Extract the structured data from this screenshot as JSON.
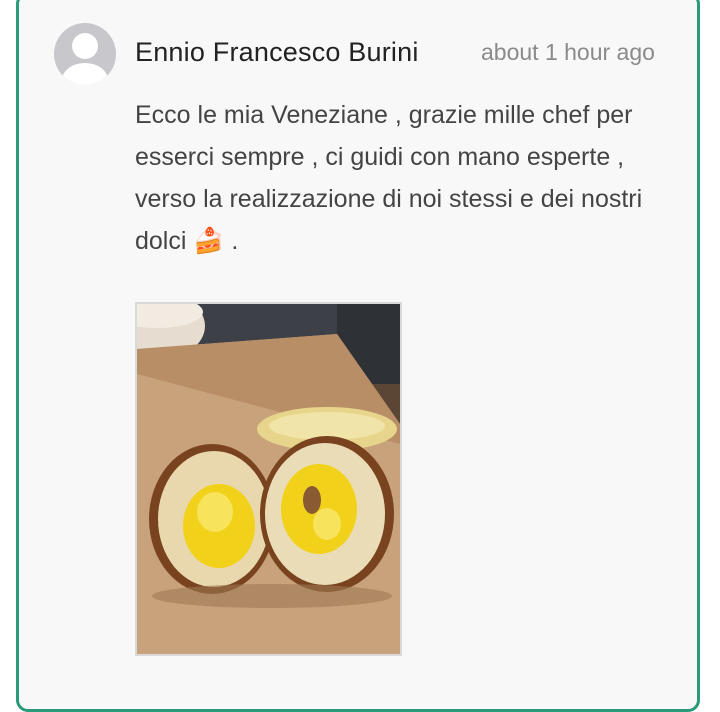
{
  "comment": {
    "author": "Ennio Francesco Burini",
    "timestamp": "about 1 hour ago",
    "text": "Ecco le mia Veneziane , grazie mille chef per esserci sempre , ci guidi con mano esperte , verso la realizzazione di noi stessi e dei nostri dolci 🍰 .",
    "image_alt": "Veneziana cut in half showing yellow custard filling"
  },
  "colors": {
    "accent_border": "#2b9a7a",
    "author_text": "#222222",
    "timestamp_text": "#8a8a8a",
    "body_text": "#444444"
  },
  "icons": {
    "avatar": "default-user-avatar-icon"
  }
}
